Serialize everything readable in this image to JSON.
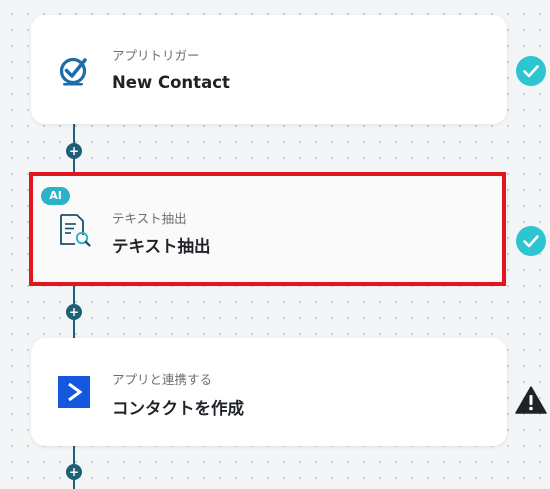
{
  "flow": {
    "steps": [
      {
        "subtitle": "アプリトリガー",
        "title": "New Contact",
        "icon": "checkbox-logo-icon",
        "status": "check-icon"
      },
      {
        "badge": "AI",
        "subtitle": "テキスト抽出",
        "title": "テキスト抽出",
        "icon": "document-search-icon",
        "status": "check-icon",
        "highlighted": true
      },
      {
        "subtitle": "アプリと連携する",
        "title": "コンタクトを作成",
        "icon": "activecampaign-logo-icon",
        "status": "warning-icon"
      }
    ],
    "add_button_glyph": "+"
  },
  "colors": {
    "connector": "#1f5f78",
    "check": "#2ec5d3",
    "highlight": "#e2161f",
    "ai_badge": "#2ab3c6",
    "app_logo_blue": "#1458e0",
    "warning": "#1f2328"
  }
}
